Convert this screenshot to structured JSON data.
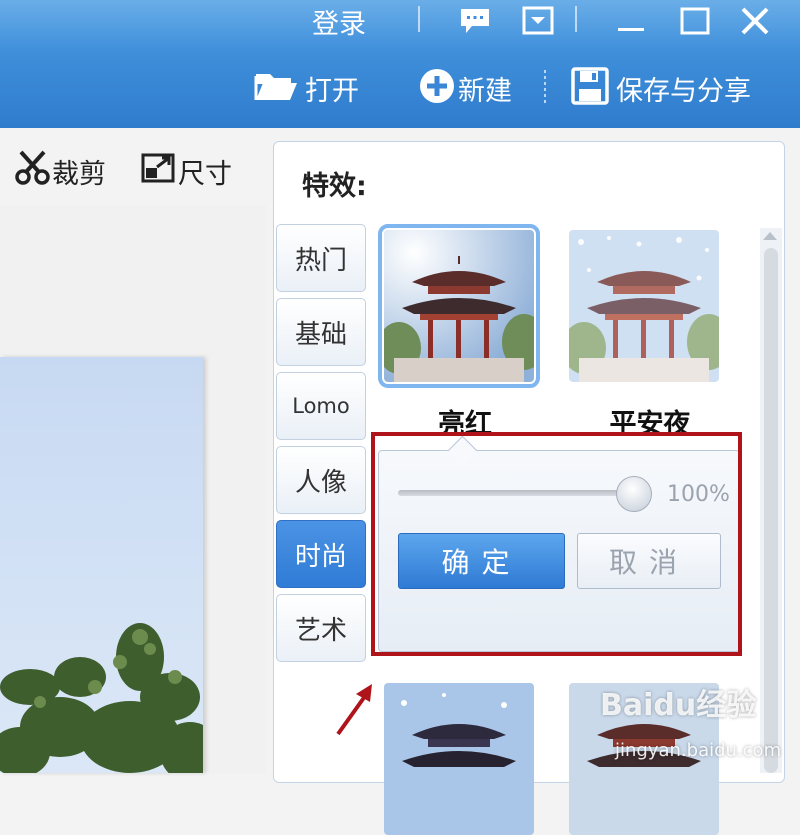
{
  "titlebar": {
    "login": "登录",
    "open_label": "打开",
    "new_label": "新建",
    "save_share_label": "保存与分享"
  },
  "toolbar": {
    "crop_label": "裁剪",
    "size_label": "尺寸"
  },
  "effects": {
    "title": "特效:",
    "tabs": [
      "热门",
      "基础",
      "Lomo",
      "人像",
      "时尚",
      "艺术"
    ],
    "active_tab": "时尚",
    "thumbnails": [
      {
        "label": "亮红",
        "selected": true
      },
      {
        "label": "平安夜",
        "selected": false
      }
    ],
    "popup": {
      "intensity_percent": 100,
      "intensity_text": "100%",
      "ok_label": "确定",
      "cancel_label": "取消"
    }
  },
  "watermark": {
    "brand": "Baidu经验",
    "url": "jingyan.baidu.com"
  },
  "colors": {
    "titlebar_blue": "#3f8fdb",
    "accent_blue": "#2f7bd6",
    "highlight_red": "#b0141b"
  }
}
